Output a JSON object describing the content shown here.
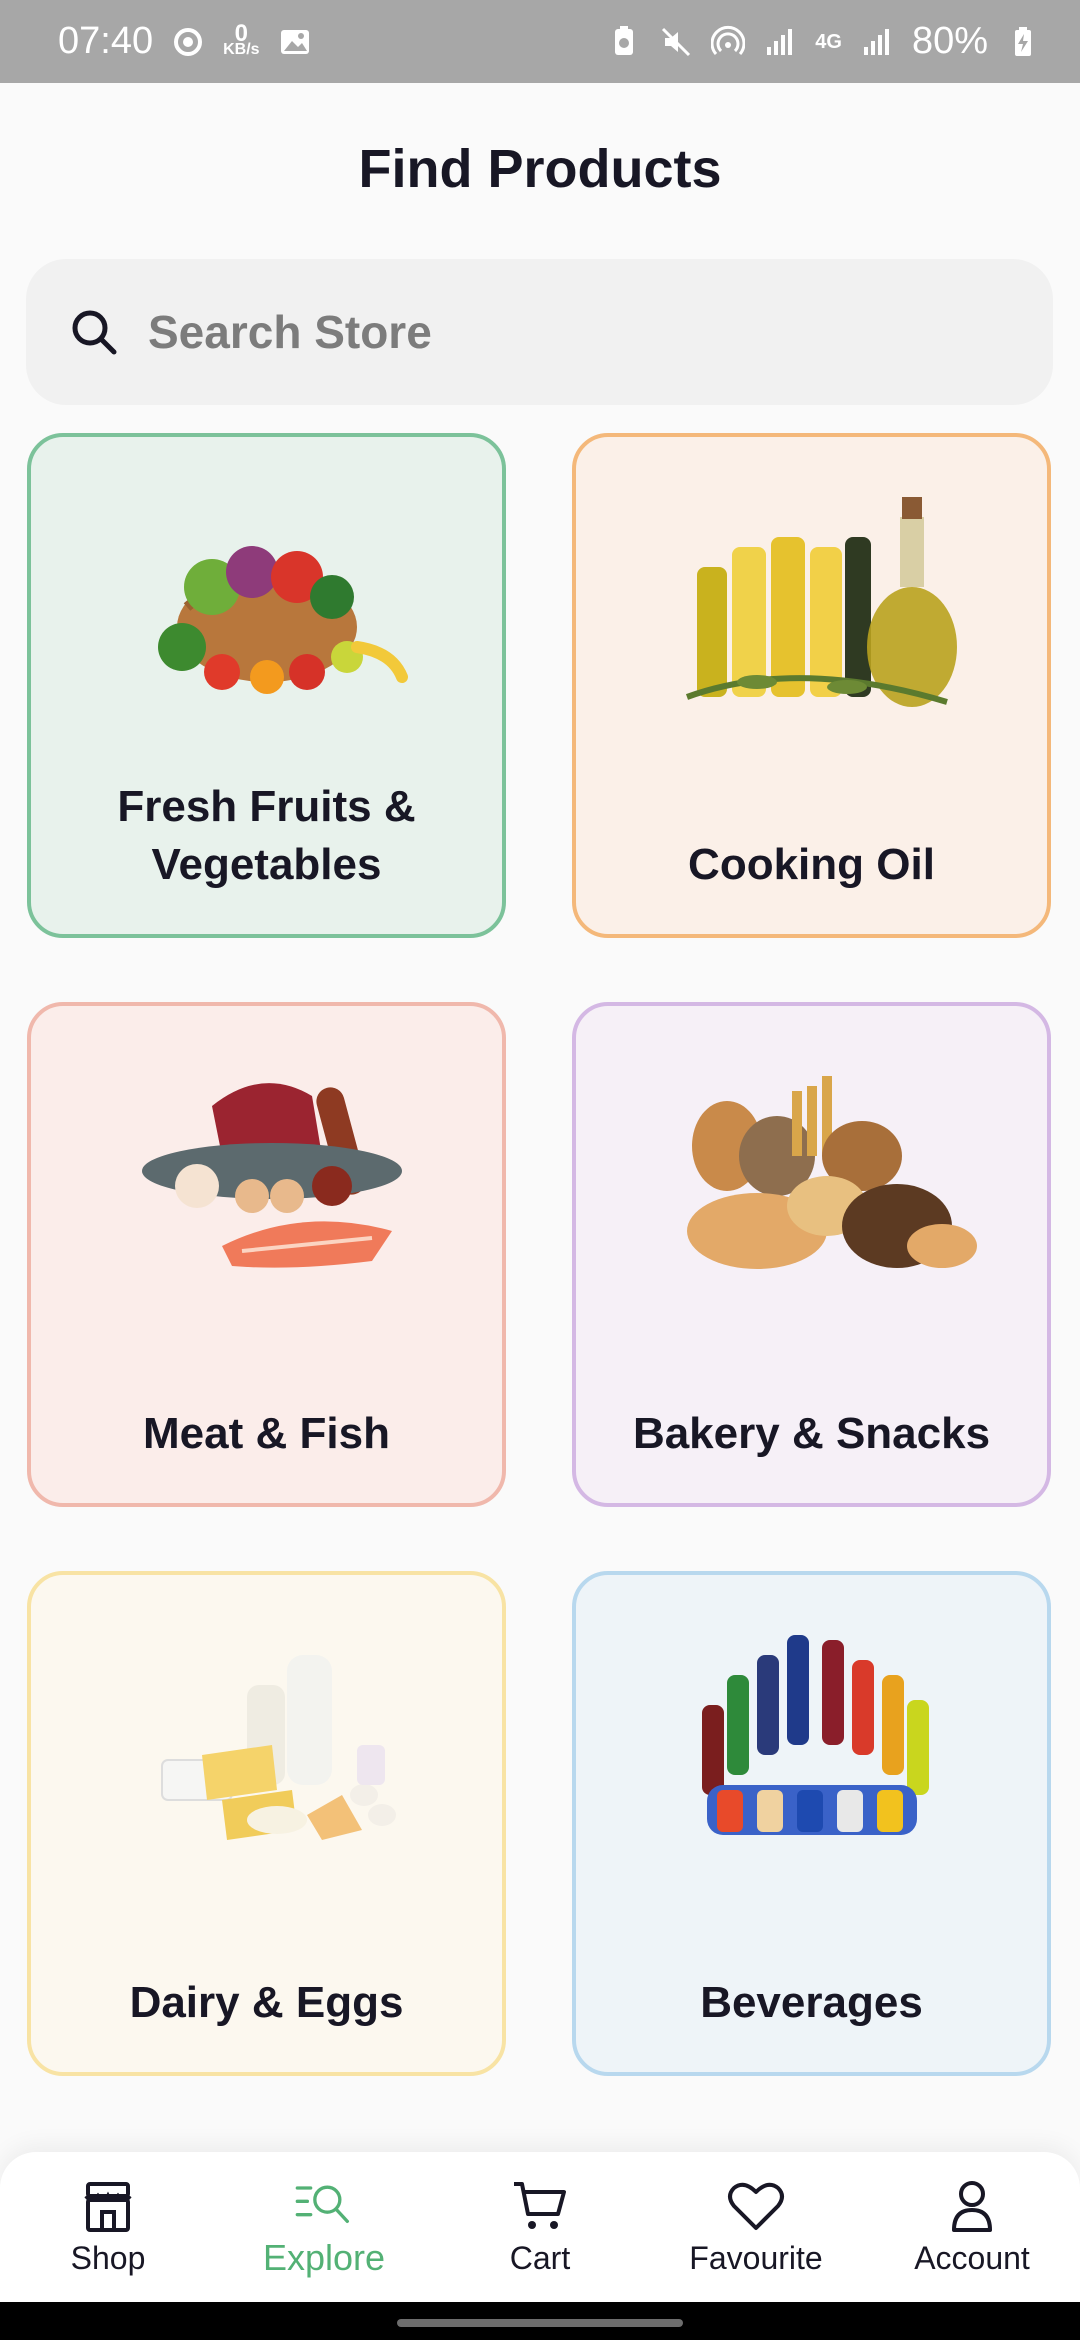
{
  "status_bar": {
    "time": "07:40",
    "net_speed_value": "0",
    "net_speed_unit": "KB/s",
    "network": "4G",
    "battery": "80%"
  },
  "title": "Find Products",
  "search": {
    "placeholder": "Search Store",
    "icon": "search-icon"
  },
  "categories": [
    {
      "label": "Fresh Fruits & Vegetables",
      "image": "fruits-vegetables-basket",
      "bg": "#e8f2ec",
      "border": "#7cc29a"
    },
    {
      "label": "Cooking Oil",
      "image": "oil-bottles",
      "bg": "#fbf0e8",
      "border": "#f4b87a"
    },
    {
      "label": "Meat & Fish",
      "image": "meat-and-fish",
      "bg": "#fbedea",
      "border": "#f0b8ac"
    },
    {
      "label": "Bakery & Snacks",
      "image": "bread-loaves",
      "bg": "#f6f0f7",
      "border": "#d4b8e4"
    },
    {
      "label": "Dairy & Eggs",
      "image": "dairy-products",
      "bg": "#fcf8ef",
      "border": "#f8e3a4"
    },
    {
      "label": "Beverages",
      "image": "soft-drink-bottles",
      "bg": "#eef4f8",
      "border": "#b8d8ee"
    }
  ],
  "bottom_nav": [
    {
      "label": "Shop",
      "icon": "store-icon",
      "active": false
    },
    {
      "label": "Explore",
      "icon": "explore-icon",
      "active": true
    },
    {
      "label": "Cart",
      "icon": "cart-icon",
      "active": false
    },
    {
      "label": "Favourite",
      "icon": "heart-icon",
      "active": false
    },
    {
      "label": "Account",
      "icon": "person-icon",
      "active": false
    }
  ],
  "colors": {
    "accent": "#53b175",
    "text": "#181725",
    "muted": "#7c7c7c"
  }
}
